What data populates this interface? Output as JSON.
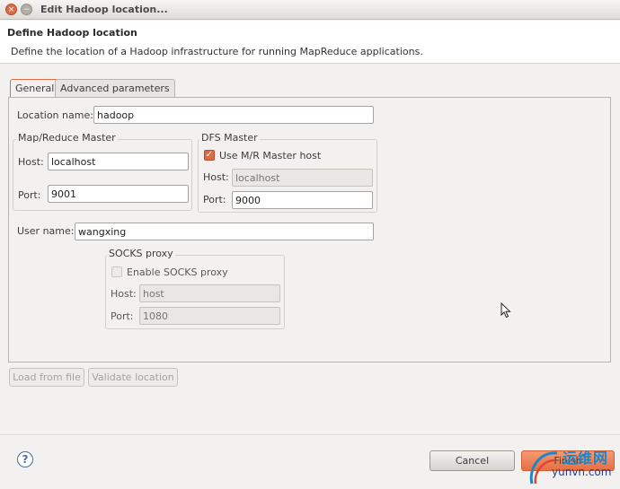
{
  "window": {
    "title": "Edit Hadoop location...",
    "close_glyph": "×",
    "min_glyph": "−"
  },
  "header": {
    "title": "Define Hadoop location",
    "description": "Define the location of a Hadoop infrastructure for running MapReduce applications."
  },
  "tabs": [
    {
      "label": "General",
      "active": true
    },
    {
      "label": "Advanced parameters",
      "active": false
    }
  ],
  "general": {
    "location_name_label": "Location name:",
    "location_name_value": "hadoop",
    "mr_master": {
      "title": "Map/Reduce Master",
      "host_label": "Host:",
      "host_value": "localhost",
      "port_label": "Port:",
      "port_value": "9001"
    },
    "dfs_master": {
      "title": "DFS Master",
      "use_mr_label": "Use M/R Master host",
      "use_mr_checked": true,
      "host_label": "Host:",
      "host_placeholder": "localhost",
      "port_label": "Port:",
      "port_value": "9000"
    },
    "user_name_label": "User name:",
    "user_name_value": "wangxing",
    "socks": {
      "title": "SOCKS proxy",
      "enable_label": "Enable SOCKS proxy",
      "enable_checked": false,
      "host_label": "Host:",
      "host_placeholder": "host",
      "port_label": "Port:",
      "port_placeholder": "1080"
    }
  },
  "actions": {
    "load_from_file": "Load from file",
    "validate_location": "Validate location"
  },
  "footer": {
    "help_glyph": "?",
    "cancel": "Cancel",
    "finish": "Finish"
  },
  "watermark": {
    "cn_text": "运维网",
    "url_text": "yunvn.com"
  },
  "colors": {
    "accent": "#de6b43",
    "watermark_blue": "#1f86c8"
  }
}
